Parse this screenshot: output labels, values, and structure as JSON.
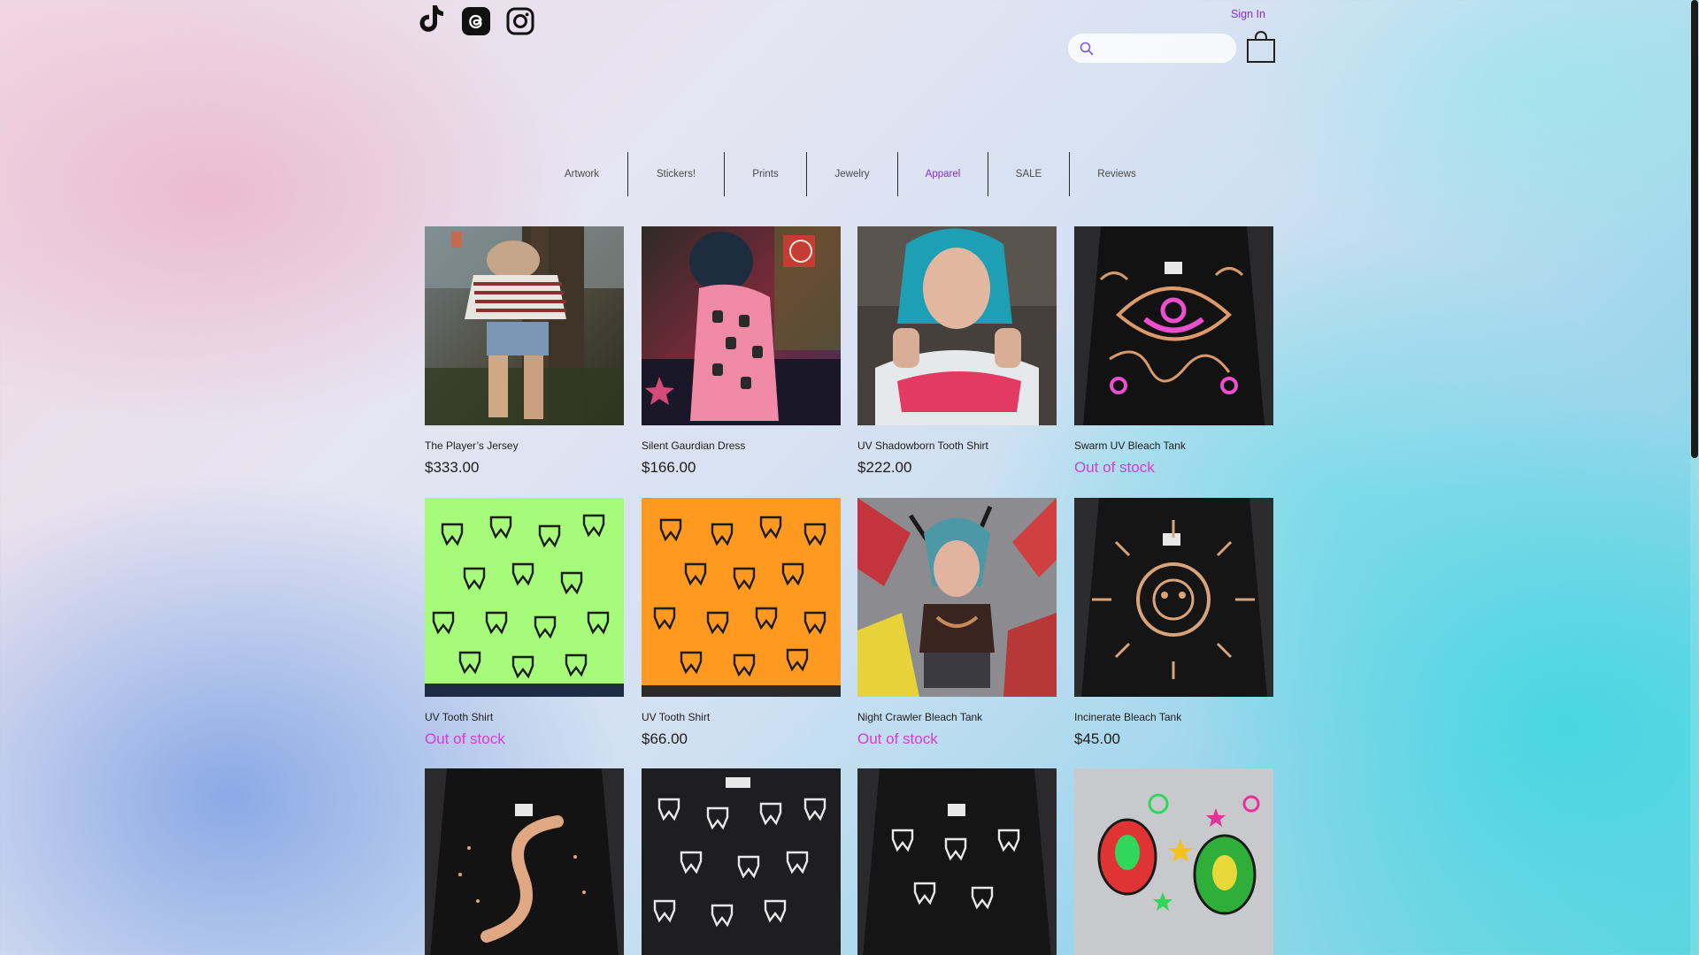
{
  "header": {
    "sign_in": "Sign In",
    "search": {
      "placeholder": "",
      "value": ""
    },
    "social_icons": [
      "tiktok-icon",
      "threads-icon",
      "instagram-icon"
    ],
    "cart_icon": "shopping-bag-icon"
  },
  "nav": {
    "items": [
      {
        "label": "Artwork"
      },
      {
        "label": "Stickers!"
      },
      {
        "label": "Prints"
      },
      {
        "label": "Jewelry"
      },
      {
        "label": "Apparel",
        "active": true
      },
      {
        "label": "SALE"
      },
      {
        "label": "Reviews"
      }
    ]
  },
  "colors": {
    "accent": "#8a2ad8",
    "out_of_stock": "#d43cd4",
    "text": "#1c1c1c"
  },
  "products": [
    {
      "name": "The Player’s Jersey",
      "price": "$333.00",
      "out_of_stock": false
    },
    {
      "name": "Silent Gaurdian Dress",
      "price": "$166.00",
      "out_of_stock": false
    },
    {
      "name": "UV Shadowborn Tooth Shirt",
      "price": "$222.00",
      "out_of_stock": false
    },
    {
      "name": "Swarm UV Bleach Tank",
      "price": "Out of stock",
      "out_of_stock": true
    },
    {
      "name": "UV Tooth Shirt",
      "price": "Out of stock",
      "out_of_stock": true
    },
    {
      "name": "UV Tooth Shirt",
      "price": "$66.00",
      "out_of_stock": false
    },
    {
      "name": "Night Crawler Bleach Tank",
      "price": "Out of stock",
      "out_of_stock": true
    },
    {
      "name": "Incinerate Bleach Tank",
      "price": "$45.00",
      "out_of_stock": false
    },
    {
      "name": "",
      "price": ""
    },
    {
      "name": "",
      "price": ""
    },
    {
      "name": "",
      "price": ""
    },
    {
      "name": "",
      "price": ""
    }
  ]
}
